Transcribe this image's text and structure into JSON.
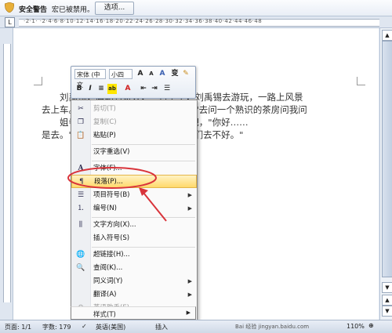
{
  "security_bar": {
    "title": "安全警告",
    "message": "宏已被禁用。",
    "options_button": "选项..."
  },
  "ruler": {
    "numbers": "·2·1· ·2·4·6·8·10·12·14·16·18·20·22·24·26·28·30·32·34·36·38·40·42·44·46·48"
  },
  "document": {
    "lines": [
      "　　刘禹锡，唐朝名诗人，一日上午，刘禹锡去游玩，一路上风景",
      "去上车。一路上看见一个小孩，他问：\"去问一个熟识的茶房问我问",
      "　　姐寺来。\"刘禹锡，要多一个朋友吧，\"你好……",
      "是去。\"刘禹锡去看一眼，\"不要紧，他们去不好。\""
    ]
  },
  "mini_toolbar": {
    "font": "宋体 (中文",
    "size": "小四",
    "row1_buttons": [
      "A",
      "A",
      "A",
      "变",
      "✎"
    ],
    "row2_buttons": [
      "B",
      "I",
      "≡",
      "ab",
      "A",
      "⇤",
      "⇥",
      "☰"
    ]
  },
  "context_menu": {
    "items": [
      {
        "label": "剪切(T)",
        "icon": "scissors-icon",
        "enabled": false
      },
      {
        "label": "复制(C)",
        "icon": "copy-icon",
        "enabled": false
      },
      {
        "label": "粘贴(P)",
        "icon": "paste-icon",
        "enabled": true
      },
      {
        "label": "汉字重选(V)",
        "icon": "",
        "enabled": true
      },
      {
        "label": "字体(F)...",
        "icon": "font-icon",
        "enabled": true
      },
      {
        "label": "段落(P)...",
        "icon": "paragraph-icon",
        "enabled": true,
        "highlighted": true
      },
      {
        "label": "项目符号(B)",
        "icon": "bullets-icon",
        "enabled": true,
        "submenu": true
      },
      {
        "label": "编号(N)",
        "icon": "numbering-icon",
        "enabled": true,
        "submenu": true
      },
      {
        "label": "文字方向(X)...",
        "icon": "text-direction-icon",
        "enabled": true
      },
      {
        "label": "插入符号(S)",
        "icon": "",
        "enabled": true
      },
      {
        "label": "超链接(H)...",
        "icon": "hyperlink-icon",
        "enabled": true
      },
      {
        "label": "查阅(K)...",
        "icon": "lookup-icon",
        "enabled": true
      },
      {
        "label": "同义词(Y)",
        "icon": "",
        "enabled": true,
        "submenu": true
      },
      {
        "label": "翻译(A)",
        "icon": "",
        "enabled": true,
        "submenu": true
      },
      {
        "label": "英语助手(E)",
        "icon": "english-assistant-icon",
        "enabled": false
      },
      {
        "label": "样式(T)",
        "icon": "",
        "enabled": true,
        "submenu": true
      }
    ]
  },
  "status_bar": {
    "page": "页面: 1/1",
    "words": "字数: 179",
    "language": "英语(美国)",
    "mode": "插入",
    "zoom": "110%"
  },
  "watermark": "Bai 经验 jingyan.baidu.com",
  "colors": {
    "highlight": "#ffd96b",
    "annotation": "#d9343b"
  }
}
